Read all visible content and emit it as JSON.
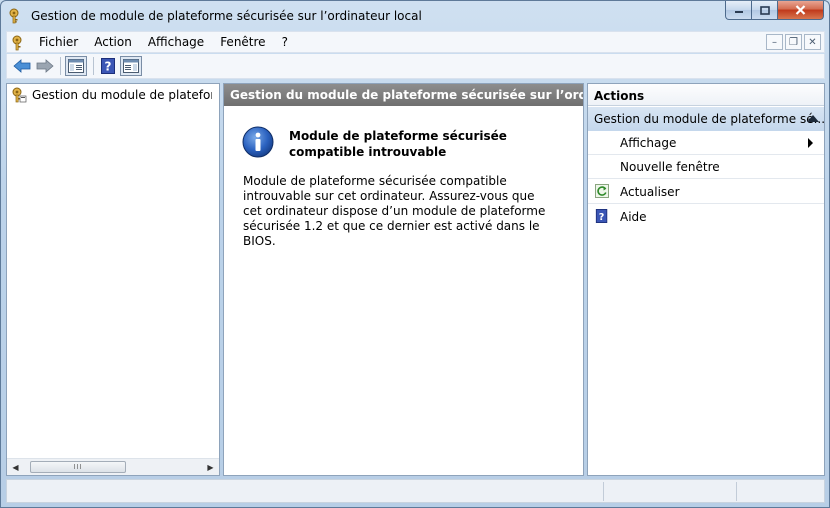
{
  "window": {
    "title": "Gestion de module de plateforme sécurisée sur l’ordinateur local",
    "colors": {
      "close_button": "#c0391a",
      "header_gray": "#7a7a7a",
      "actions_group": "#c8d9ec",
      "link_blue": "#1a5bb5"
    }
  },
  "menubar": {
    "items": [
      "Fichier",
      "Action",
      "Affichage",
      "Fenêtre",
      "?"
    ]
  },
  "toolbar": {
    "buttons": [
      "back-icon",
      "forward-icon",
      "show-hide-console-tree-icon",
      "help-icon",
      "show-hide-action-pane-icon"
    ]
  },
  "tree": {
    "item_label": "Gestion du module de plateforme sécurisée sur l’ordinateur local",
    "scroll_thumb_glyph": "III"
  },
  "center": {
    "header": "Gestion du module de plateforme sécurisée sur l’ordinateur lo...",
    "message_title": "Module de plateforme sécurisée compatible introuvable",
    "message_body": "Module de plateforme sécurisée compatible introuvable sur cet ordinateur. Assurez-vous que cet ordinateur dispose d’un module de plateforme sécurisée 1.2 et que ce dernier est activé dans le BIOS."
  },
  "actions": {
    "header": "Actions",
    "group_label": "Gestion du module de plateforme sé...",
    "items": [
      {
        "label": "Affichage",
        "icon": "",
        "has_submenu": true
      },
      {
        "label": "Nouvelle fenêtre",
        "icon": "",
        "has_submenu": false
      },
      {
        "label": "Actualiser",
        "icon": "refresh-icon",
        "has_submenu": false
      },
      {
        "label": "Aide",
        "icon": "help-icon",
        "has_submenu": false
      }
    ]
  }
}
